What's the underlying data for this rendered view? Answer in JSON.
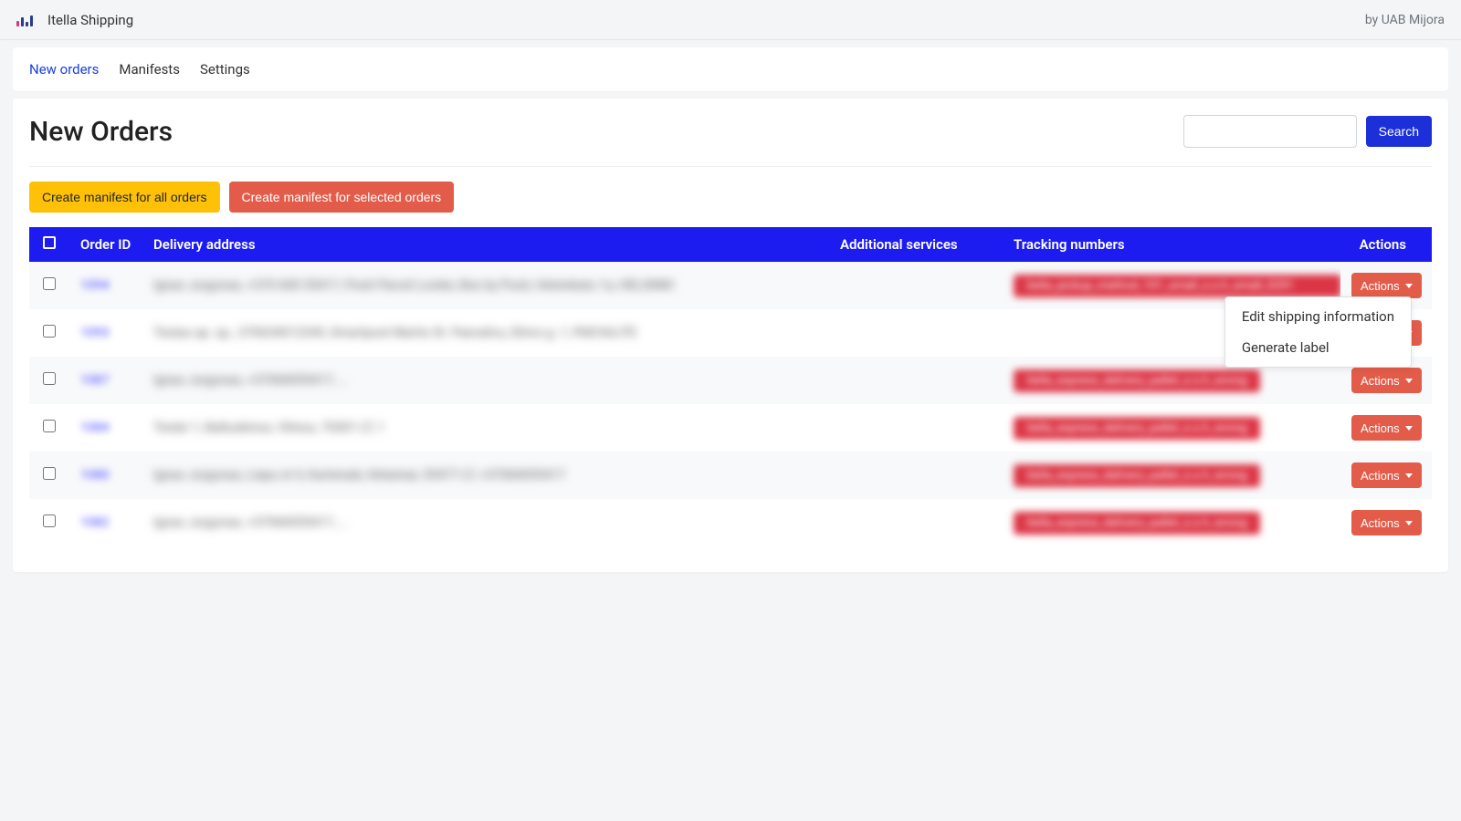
{
  "header": {
    "app_title": "Itella Shipping",
    "vendor": "by UAB Mijora"
  },
  "nav": {
    "tabs": [
      {
        "label": "New orders",
        "active": true
      },
      {
        "label": "Manifests",
        "active": false
      },
      {
        "label": "Settings",
        "active": false
      }
    ]
  },
  "page": {
    "title": "New Orders",
    "search_placeholder": "",
    "search_button": "Search"
  },
  "toolbar": {
    "create_all": "Create manifest for all orders",
    "create_selected": "Create manifest for selected orders"
  },
  "table": {
    "columns": {
      "order_id": "Order ID",
      "delivery_address": "Delivery address",
      "additional_services": "Additional services",
      "tracking_numbers": "Tracking numbers",
      "actions": "Actions"
    },
    "action_button": "Actions",
    "dropdown": {
      "edit": "Edit shipping information",
      "generate": "Generate label"
    },
    "rows": [
      {
        "id": "1094",
        "address": "Ignas Jurgonas, +370 600 55417, Posti Parcel Locker, Box by Posti, Helsinkatu 1a, HELSINKI",
        "tracking": "itella_pickup_method_101_small_s.s.h_small_0291",
        "tracking_wide": true
      },
      {
        "id": "1093",
        "address": "Testas ap. sp., 370634012345, Smartpost Martis St. Paevalivu, Elinro g. 1, PAEVALITE",
        "tracking": "",
        "tracking_wide": false
      },
      {
        "id": "1087",
        "address": "Ignas Jurgonas, +37060055417, …",
        "tracking": "itella_express_delivery_pallet_s.s.h_wrong",
        "tracking_wide": false
      },
      {
        "id": "1084",
        "address": "Tester 1, Baltuskinos, Vilnius, 70301 LT, 1",
        "tracking": "itella_express_delivery_pallet_s.s.h_wrong",
        "tracking_wide": false
      },
      {
        "id": "1080",
        "address": "Ignas Jurgonas, Liepu st 4, Kartenale, Kėtainiai, 55477 LT, +37060055417",
        "tracking": "itella_express_delivery_pallet_s.s.h_wrong",
        "tracking_wide": false
      },
      {
        "id": "1082",
        "address": "Ignas Jurgonas, +37060055417, …",
        "tracking": "itella_express_delivery_pallet_s.s.h_wrong",
        "tracking_wide": false
      }
    ]
  }
}
